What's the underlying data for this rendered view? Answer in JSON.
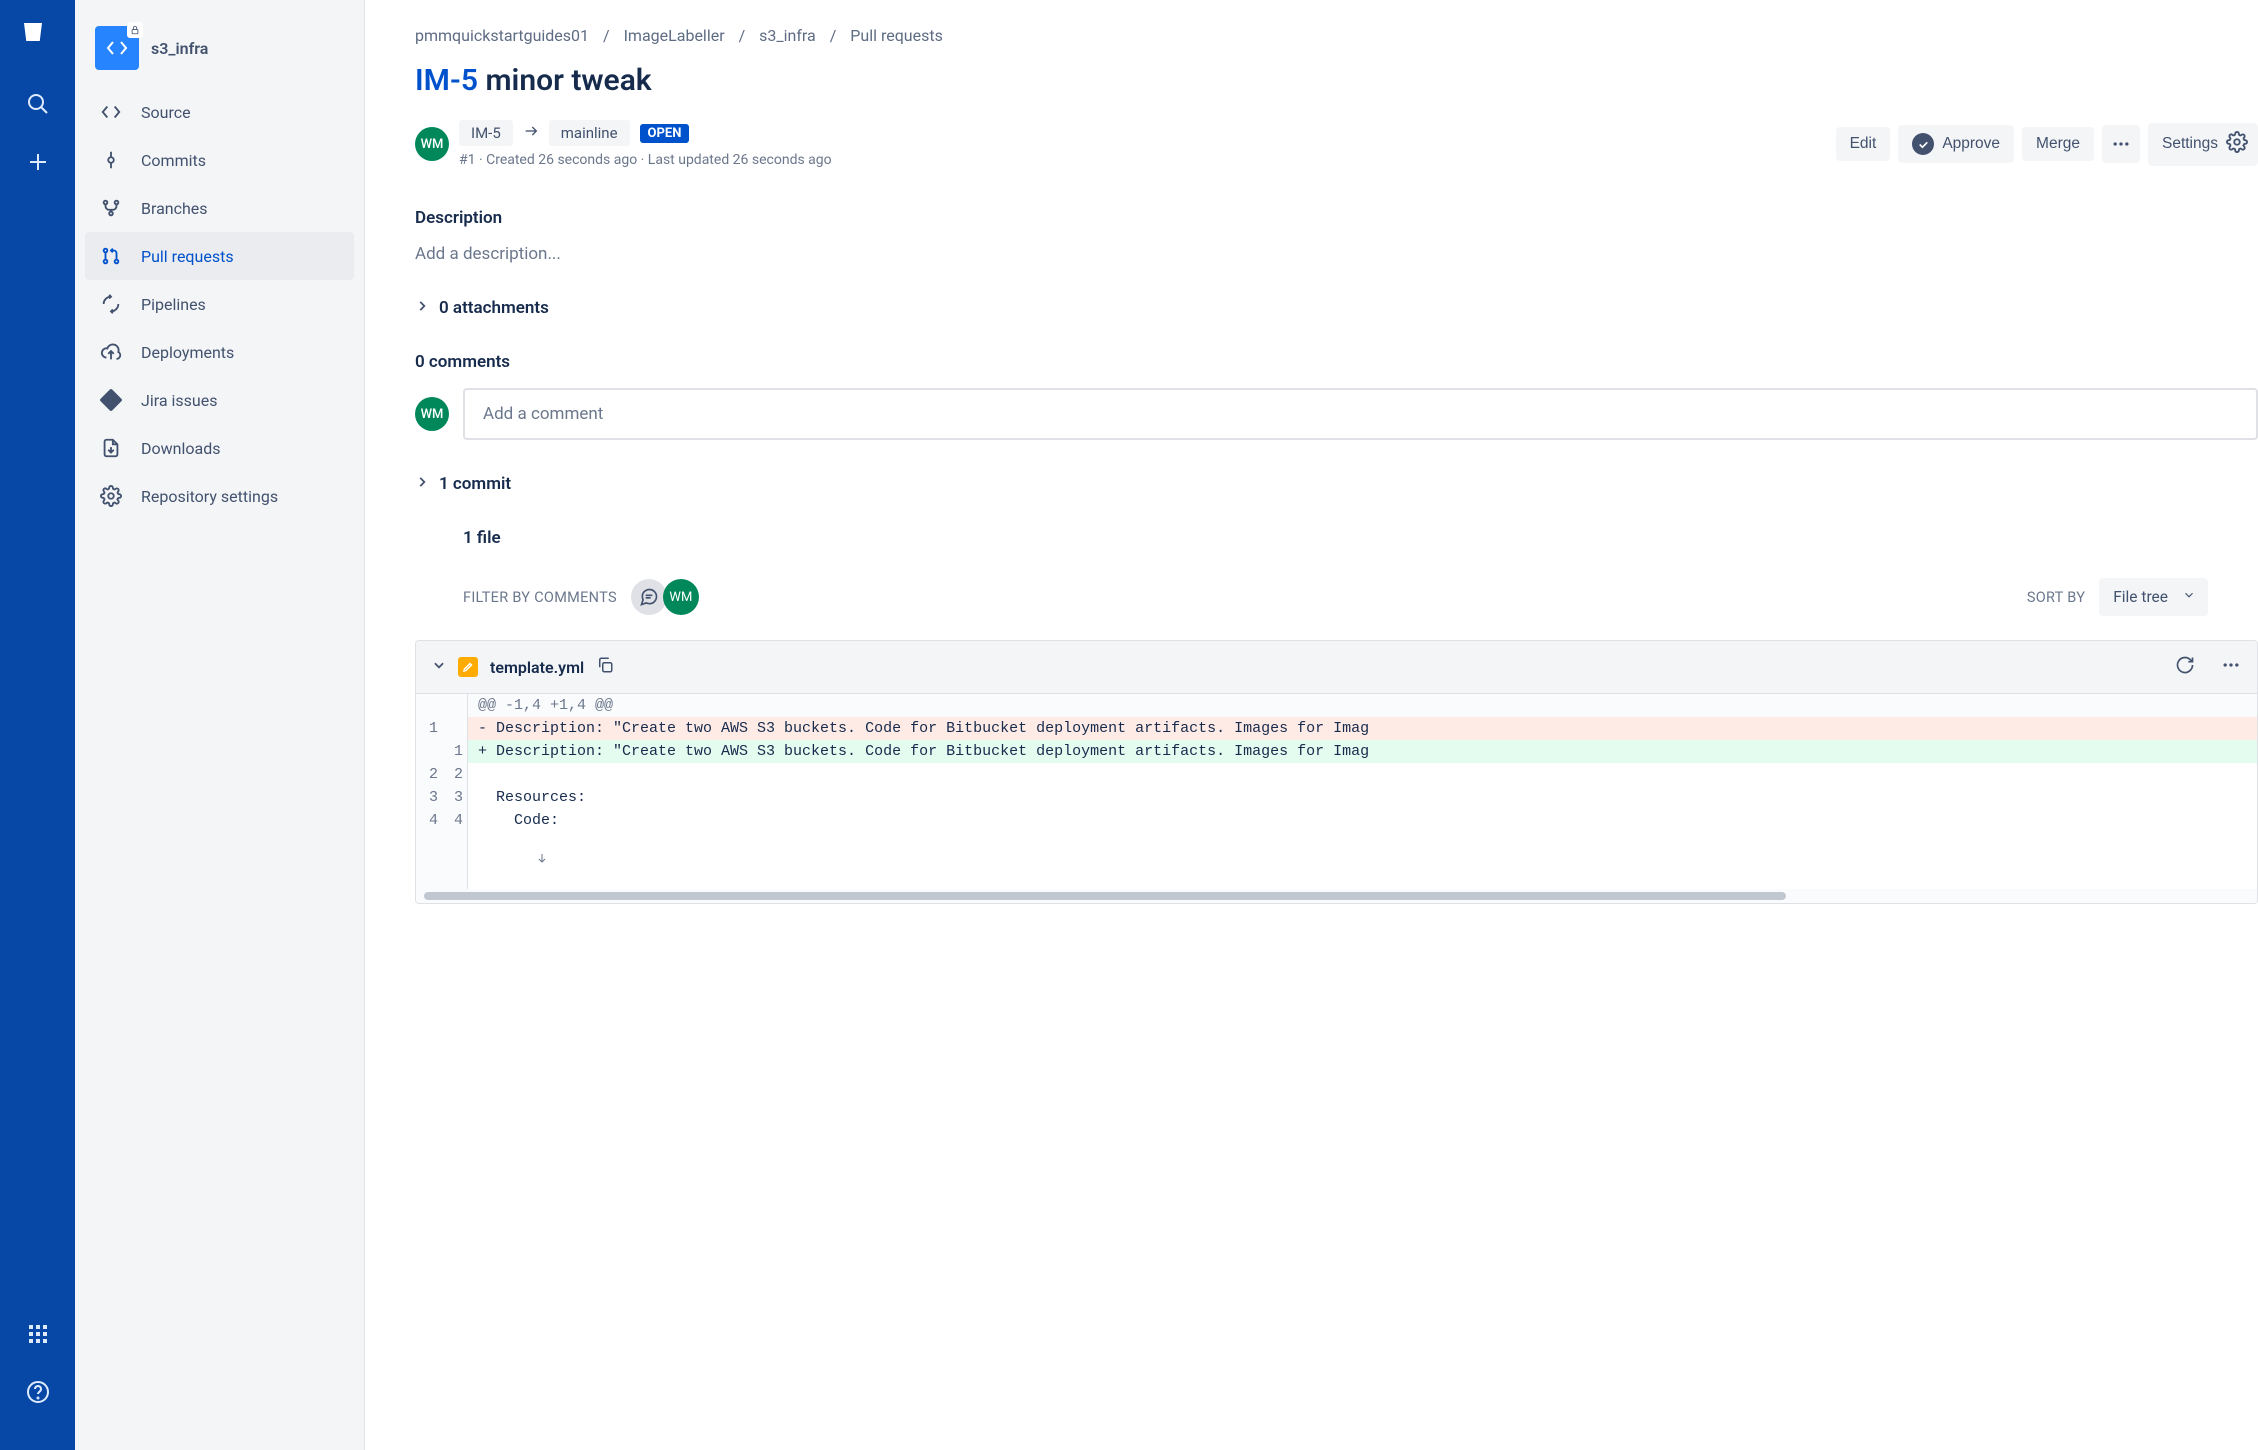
{
  "repo": {
    "name": "s3_infra"
  },
  "globalNav": {
    "logoLetter": "bitbucket"
  },
  "sidebar": {
    "items": [
      {
        "label": "Source"
      },
      {
        "label": "Commits"
      },
      {
        "label": "Branches"
      },
      {
        "label": "Pull requests"
      },
      {
        "label": "Pipelines"
      },
      {
        "label": "Deployments"
      },
      {
        "label": "Jira issues"
      },
      {
        "label": "Downloads"
      },
      {
        "label": "Repository settings"
      }
    ]
  },
  "breadcrumb": {
    "items": [
      "pmmquickstartguides01",
      "ImageLabeller",
      "s3_infra",
      "Pull requests"
    ]
  },
  "pr": {
    "issueKey": "IM-5",
    "titleRest": " minor tweak",
    "sourceBranch": "IM-5",
    "targetBranch": "mainline",
    "statusBadge": "OPEN",
    "authorInitials": "WM",
    "timestamps": "#1 · Created 26 seconds ago · Last updated 26 seconds ago",
    "actions": {
      "edit": "Edit",
      "approve": "Approve",
      "merge": "Merge",
      "settings": "Settings"
    }
  },
  "description": {
    "heading": "Description",
    "placeholder": "Add a description..."
  },
  "attachments": {
    "label": "0 attachments"
  },
  "comments": {
    "heading": "0 comments",
    "placeholder": "Add a comment",
    "authorInitials": "WM"
  },
  "commits": {
    "label": "1 commit"
  },
  "files": {
    "count": "1 file",
    "filterLabel": "FILTER BY COMMENTS",
    "filterUserInitials": "WM",
    "sortLabel": "SORT BY",
    "sortValue": "File tree"
  },
  "diff": {
    "fileName": "template.yml",
    "hunk": "@@ -1,4 +1,4 @@",
    "lines": [
      {
        "oldNo": "1",
        "newNo": "",
        "type": "del",
        "prefix": "- ",
        "text": "Description: \"Create two AWS S3 buckets. Code for Bitbucket deployment artifacts. Images for Imag"
      },
      {
        "oldNo": "",
        "newNo": "1",
        "type": "add",
        "prefix": "+ ",
        "text": "Description: \"Create two AWS S3 buckets. Code for Bitbucket deployment artifacts. Images for Imag"
      },
      {
        "oldNo": "2",
        "newNo": "2",
        "type": "ctx",
        "prefix": "  ",
        "text": ""
      },
      {
        "oldNo": "3",
        "newNo": "3",
        "type": "ctx",
        "prefix": "  ",
        "text": "Resources:"
      },
      {
        "oldNo": "4",
        "newNo": "4",
        "type": "ctx",
        "prefix": "  ",
        "text": "  Code:"
      }
    ]
  }
}
